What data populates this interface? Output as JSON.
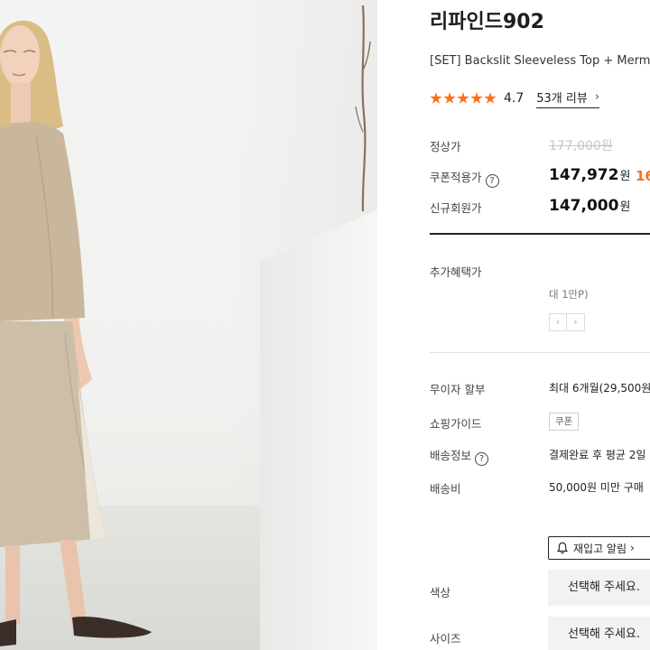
{
  "product": {
    "brand": "리파인드902",
    "title": "[SET] Backslit Sleeveless Top + Mermai",
    "rating": "4.7",
    "review_label": "53개 리뷰",
    "review_chevron": "›",
    "star_count": 5
  },
  "prices": {
    "regular_label": "정상가",
    "regular_value": "177,000",
    "regular_unit": "원",
    "coupon_label": "쿠폰적용가",
    "coupon_value": "147,972",
    "coupon_unit": "원",
    "discount": "16",
    "new_member_label": "신규회원가",
    "new_member_value": "147,000",
    "new_member_unit": "원"
  },
  "benefits": {
    "label": "추가혜택가",
    "note": "대 1만P)",
    "prev": "‹",
    "next": "›"
  },
  "info_rows": {
    "installment_label": "무이자 할부",
    "installment_value": "최대 6개월(29,500원",
    "guide_label": "쇼핑가이드",
    "guide_chip": "쿠폰",
    "shipping_label": "배송정보",
    "shipping_value": "결제완료 후 평균 2일",
    "fee_label": "배송비",
    "fee_value": "50,000원 미만 구매"
  },
  "actions": {
    "restock_label": "재입고 알림",
    "restock_chevron": "›"
  },
  "options": {
    "color_label": "색상",
    "color_placeholder": "선택해 주세요.",
    "size_label": "사이즈",
    "size_placeholder": "선택해 주세요."
  },
  "colors": {
    "accent": "#ff6d14",
    "garment": "#c8b79c"
  },
  "icons": {
    "star": "star-icon",
    "help": "question-circle-icon",
    "bell": "bell-icon",
    "chevron": "chevron-right-icon"
  }
}
